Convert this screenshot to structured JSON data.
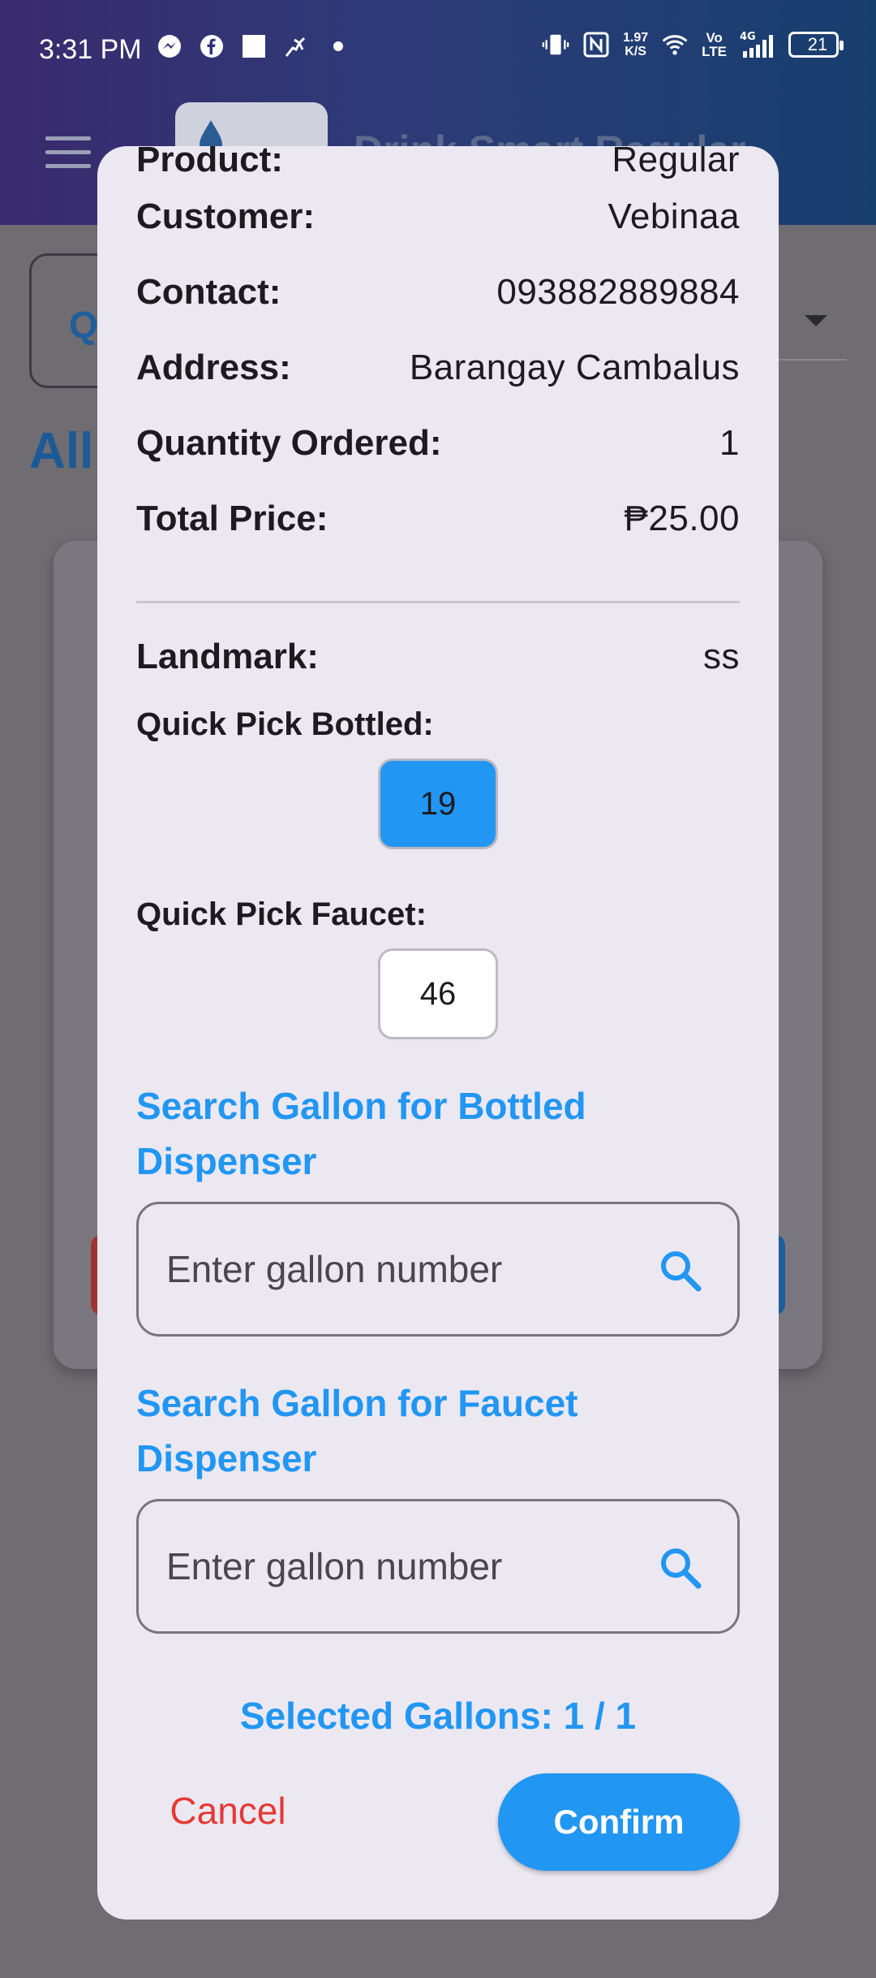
{
  "status_bar": {
    "time": "3:31 PM",
    "net_speed_value": "1.97",
    "net_speed_unit": "K/S",
    "volte_top": "Vo",
    "volte_bottom": "LTE",
    "network": "4G",
    "battery": "21",
    "icons": [
      "messenger-icon",
      "facebook-icon",
      "square-icon",
      "activity-icon",
      "dot-icon",
      "vibrate-icon",
      "nfc-icon",
      "wifi-icon",
      "signal-icon",
      "battery-icon"
    ]
  },
  "background": {
    "app_title": "Drink Smart Regular",
    "heading": "All"
  },
  "dialog": {
    "product_label": "Product:",
    "product_value": "Regular",
    "customer_label": "Customer:",
    "customer_value": "Vebinaa",
    "contact_label": "Contact:",
    "contact_value": "093882889884",
    "address_label": "Address:",
    "address_value": "Barangay Cambalus",
    "quantity_label": "Quantity Ordered:",
    "quantity_value": "1",
    "total_label": "Total Price:",
    "total_value": "₱25.00",
    "landmark_label": "Landmark:",
    "landmark_value": "ss",
    "quick_pick_bottled_label": "Quick Pick Bottled:",
    "quick_pick_bottled_value": "19",
    "quick_pick_faucet_label": "Quick Pick Faucet:",
    "quick_pick_faucet_value": "46",
    "search_bottled_title": "Search Gallon for Bottled Dispenser",
    "search_bottled_placeholder": "Enter gallon number",
    "search_faucet_title": "Search Gallon for Faucet Dispenser",
    "search_faucet_placeholder": "Enter gallon number",
    "selected_gallons": "Selected Gallons: 1 / 1",
    "cancel_label": "Cancel",
    "confirm_label": "Confirm"
  },
  "colors": {
    "accent": "#2196f3",
    "cancel": "#e53935",
    "dialog_bg": "#ece8f2"
  }
}
